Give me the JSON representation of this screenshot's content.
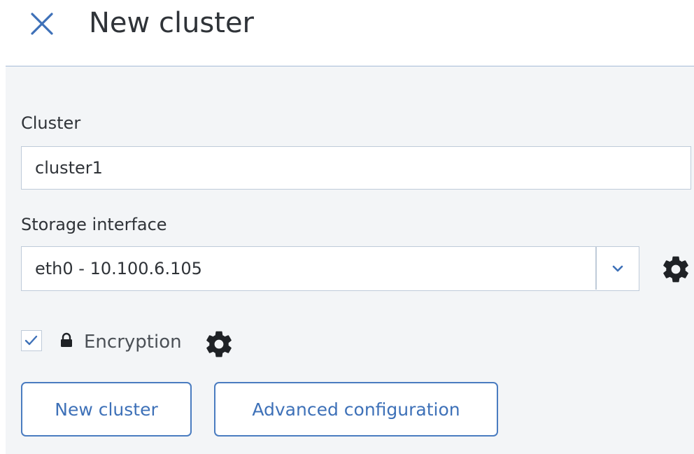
{
  "header": {
    "title": "New cluster",
    "close_icon": "close-icon"
  },
  "form": {
    "cluster": {
      "label": "Cluster",
      "value": "cluster1"
    },
    "storage_interface": {
      "label": "Storage interface",
      "selected": "eth0 - 10.100.6.105",
      "chevron_icon": "chevron-down-icon",
      "settings_icon": "gear-icon"
    },
    "encryption": {
      "label": "Encryption",
      "checked": true,
      "lock_icon": "lock-icon",
      "settings_icon": "gear-icon"
    }
  },
  "actions": {
    "new_cluster_label": "New cluster",
    "advanced_label": "Advanced configuration"
  },
  "colors": {
    "accent": "#3e71b8",
    "panel_bg": "#f3f5f7",
    "border": "#bfcbd9",
    "text": "#2f3338"
  }
}
